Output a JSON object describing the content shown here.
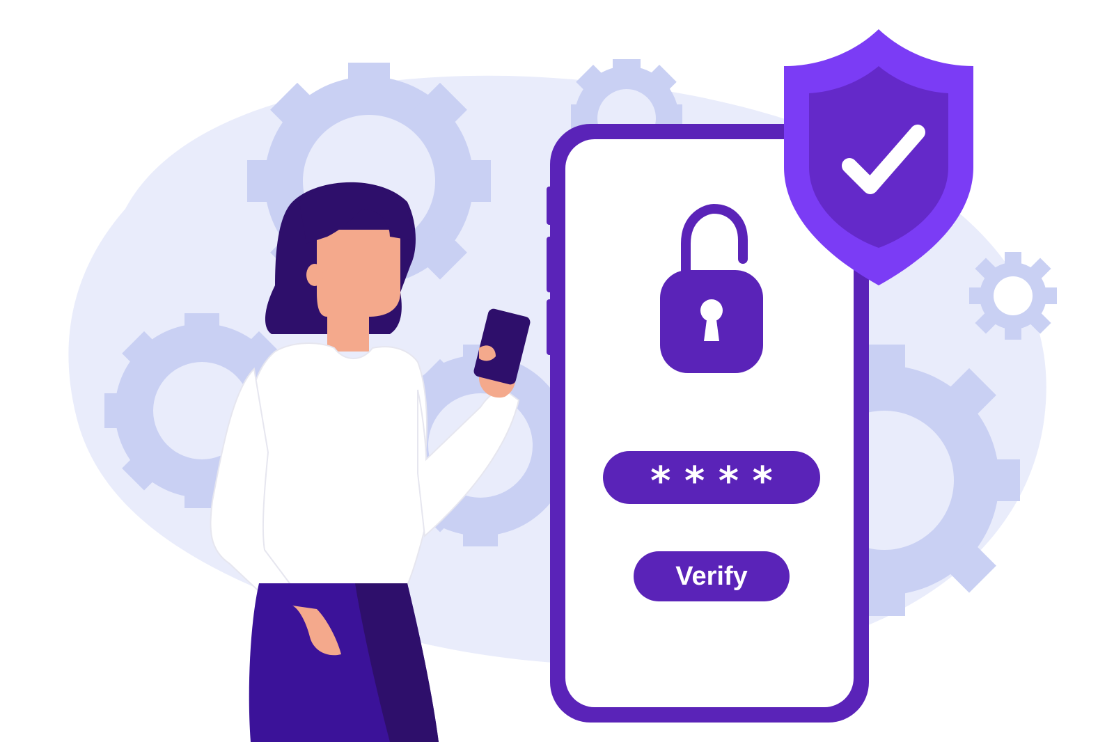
{
  "phone": {
    "password_mask": "* * * *",
    "verify_label": "Verify"
  },
  "icons": {
    "lock": "unlocked-padlock-icon",
    "shield": "shield-check-icon"
  },
  "colors": {
    "background": "#ffffff",
    "blob": "#e9ecfb",
    "gear": "#c9d0f3",
    "brand_dark": "#5a23b8",
    "brand_mid": "#6a2fd6",
    "shield_outer": "#7b3cf5",
    "shield_inner": "#6429c9",
    "hair": "#2e0f6b",
    "skin": "#f4a98c",
    "pants": "#3b1299"
  }
}
